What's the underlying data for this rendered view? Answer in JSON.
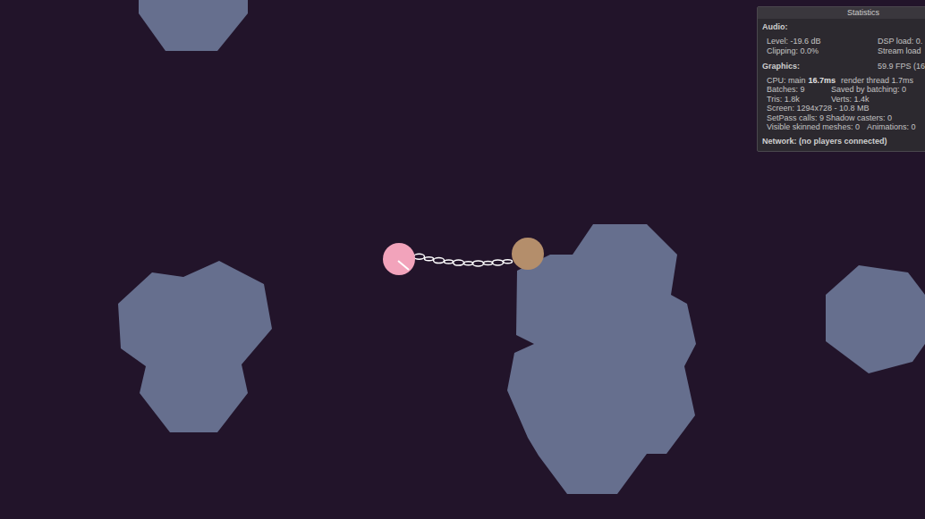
{
  "balls": [
    {
      "color": "#f2a3bb"
    },
    {
      "color": "#b48e6b"
    }
  ],
  "statistics": {
    "title": "Statistics",
    "audio": {
      "heading": "Audio:",
      "rows": [
        [
          "Level: -19.6 dB",
          "DSP load: 0."
        ],
        [
          "Clipping: 0.0%",
          "Stream load"
        ]
      ]
    },
    "graphics": {
      "heading": "Graphics:",
      "fps": "59.9 FPS (16",
      "cpu": {
        "prefix": "CPU: main",
        "main": "16.7ms",
        "render": "render thread 1.7ms"
      },
      "rows": [
        [
          "Batches: 9",
          "Saved by batching: 0"
        ],
        [
          "Tris: 1.8k",
          "Verts: 1.4k"
        ],
        [
          "Screen: 1294x728 - 10.8 MB"
        ],
        [
          "SetPass calls: 9",
          "Shadow casters: 0"
        ],
        [
          "Visible skinned meshes: 0",
          "Animations: 0"
        ]
      ]
    },
    "network": "Network: (no players connected)"
  }
}
